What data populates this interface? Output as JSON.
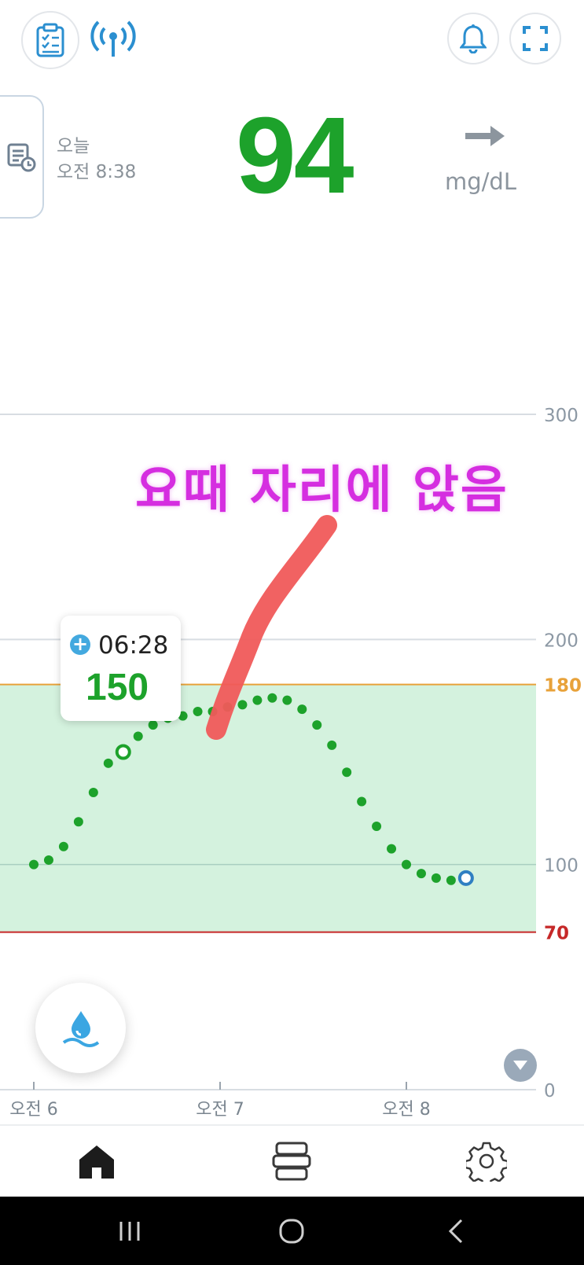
{
  "header": {
    "left_icons": [
      "clipboard-checklist-icon",
      "antenna-signal-icon"
    ],
    "right_icons": [
      "bell-icon",
      "fullscreen-icon"
    ]
  },
  "reading": {
    "day": "오늘",
    "time": "오전 8:38",
    "value": "94",
    "unit": "mg/dL",
    "trend_icon": "arrow-right-icon"
  },
  "annotation": "요때 자리에 앉음",
  "tooltip": {
    "time": "06:28",
    "value": "150"
  },
  "chart_data": {
    "type": "scatter",
    "y_ticks": [
      "300",
      "200",
      "180",
      "100",
      "70",
      "0"
    ],
    "x_ticks": [
      "오전 6",
      "오전 7",
      "오전 8"
    ],
    "target_range": [
      70,
      180
    ],
    "ylim": [
      0,
      300
    ],
    "colors": {
      "point": "#1da22b",
      "range_fill": "#d4f2de",
      "high_line": "#e8a23a",
      "low_line": "#c62828",
      "current_point": "#2f7fc2"
    },
    "points": [
      {
        "x": 0.0,
        "y": 100
      },
      {
        "x": 0.08,
        "y": 102
      },
      {
        "x": 0.16,
        "y": 108
      },
      {
        "x": 0.24,
        "y": 119
      },
      {
        "x": 0.32,
        "y": 132
      },
      {
        "x": 0.4,
        "y": 145
      },
      {
        "x": 0.48,
        "y": 150
      },
      {
        "x": 0.56,
        "y": 157
      },
      {
        "x": 0.64,
        "y": 162
      },
      {
        "x": 0.72,
        "y": 165
      },
      {
        "x": 0.8,
        "y": 166
      },
      {
        "x": 0.88,
        "y": 168
      },
      {
        "x": 0.96,
        "y": 168
      },
      {
        "x": 1.04,
        "y": 170
      },
      {
        "x": 1.12,
        "y": 171
      },
      {
        "x": 1.2,
        "y": 173
      },
      {
        "x": 1.28,
        "y": 174
      },
      {
        "x": 1.36,
        "y": 173
      },
      {
        "x": 1.44,
        "y": 169
      },
      {
        "x": 1.52,
        "y": 162
      },
      {
        "x": 1.6,
        "y": 153
      },
      {
        "x": 1.68,
        "y": 141
      },
      {
        "x": 1.76,
        "y": 128
      },
      {
        "x": 1.84,
        "y": 117
      },
      {
        "x": 1.92,
        "y": 107
      },
      {
        "x": 2.0,
        "y": 100
      },
      {
        "x": 2.08,
        "y": 96
      },
      {
        "x": 2.16,
        "y": 94
      },
      {
        "x": 2.24,
        "y": 93
      },
      {
        "x": 2.32,
        "y": 94
      }
    ],
    "highlighted_point": {
      "x": 0.48,
      "y": 150
    },
    "current_point": {
      "x": 2.32,
      "y": 94
    }
  },
  "fab": {
    "icon": "blood-drop-icon"
  },
  "tabbar": {
    "tabs": [
      "home-icon",
      "list-icon",
      "settings-icon"
    ]
  },
  "system_nav": {
    "buttons": [
      "recent-apps-icon",
      "home-circle-icon",
      "back-icon"
    ]
  }
}
